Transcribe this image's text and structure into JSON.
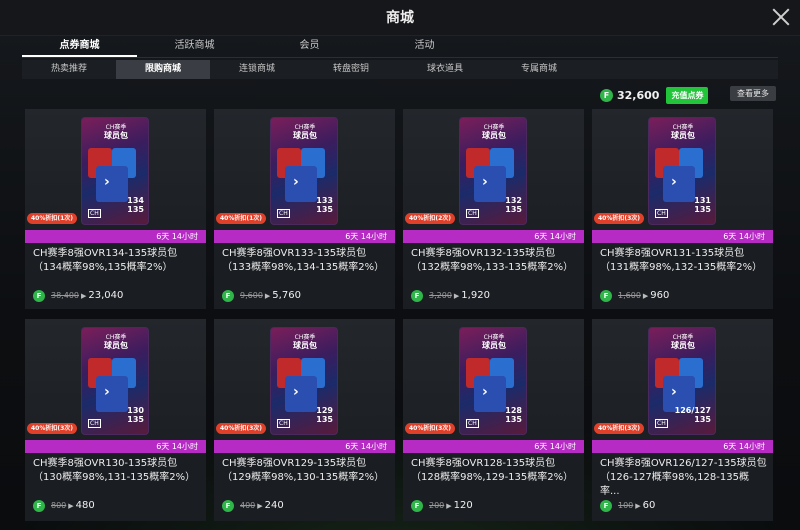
{
  "window": {
    "title": "商城"
  },
  "tabs_main": [
    {
      "label": "点券商城",
      "active": true
    },
    {
      "label": "活跃商城",
      "active": false
    },
    {
      "label": "会员",
      "active": false
    },
    {
      "label": "活动",
      "active": false
    }
  ],
  "tabs_sub": [
    {
      "label": "热卖推荐",
      "active": false
    },
    {
      "label": "限购商城",
      "active": true
    },
    {
      "label": "连锁商城",
      "active": false
    },
    {
      "label": "转盘密钥",
      "active": false
    },
    {
      "label": "球衣道具",
      "active": false
    },
    {
      "label": "专属商城",
      "active": false
    }
  ],
  "balance": {
    "coin_glyph": "F",
    "value": "32,600",
    "recharge_label": "充值点券"
  },
  "more_label": "查看更多",
  "pack_art": {
    "ch_label": "CH赛季",
    "name": "球员包",
    "ch_badge": "CH",
    "max_ovr": "135"
  },
  "products": [
    {
      "ovr": "134",
      "discount": "40%折扣(1次)",
      "time": "6天 14小时",
      "name": "CH赛季8强OVR134-135球员包（134概率98%,135概率2%）",
      "old_price": "38,400",
      "new_price": "23,040"
    },
    {
      "ovr": "133",
      "discount": "40%折扣(1次)",
      "time": "6天 14小时",
      "name": "CH赛季8强OVR133-135球员包（133概率98%,134-135概率2%）",
      "old_price": "9,600",
      "new_price": "5,760"
    },
    {
      "ovr": "132",
      "discount": "40%折扣(2次)",
      "time": "6天 14小时",
      "name": "CH赛季8强OVR132-135球员包（132概率98%,133-135概率2%）",
      "old_price": "3,200",
      "new_price": "1,920"
    },
    {
      "ovr": "131",
      "discount": "40%折扣(3次)",
      "time": "6天 14小时",
      "name": "CH赛季8强OVR131-135球员包（131概率98%,132-135概率2%）",
      "old_price": "1,600",
      "new_price": "960"
    },
    {
      "ovr": "130",
      "discount": "40%折扣(3次)",
      "time": "6天 14小时",
      "name": "CH赛季8强OVR130-135球员包（130概率98%,131-135概率2%）",
      "old_price": "800",
      "new_price": "480"
    },
    {
      "ovr": "129",
      "discount": "40%折扣(3次)",
      "time": "6天 14小时",
      "name": "CH赛季8强OVR129-135球员包（129概率98%,130-135概率2%）",
      "old_price": "400",
      "new_price": "240"
    },
    {
      "ovr": "128",
      "discount": "40%折扣(3次)",
      "time": "6天 14小时",
      "name": "CH赛季8强OVR128-135球员包（128概率98%,129-135概率2%）",
      "old_price": "200",
      "new_price": "120"
    },
    {
      "ovr": "126/127",
      "discount": "40%折扣(3次)",
      "time": "6天 14小时",
      "name": "CH赛季8强OVR126/127-135球员包（126-127概率98%,128-135概率...",
      "old_price": "100",
      "new_price": "60"
    }
  ]
}
